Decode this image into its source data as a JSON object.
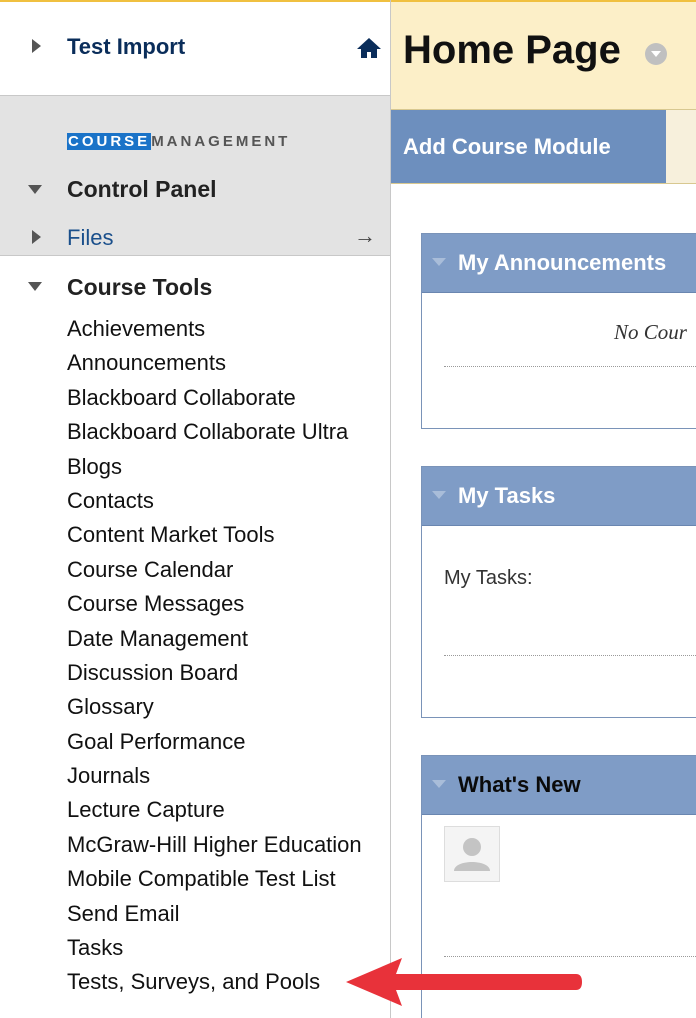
{
  "sidebar": {
    "course_title": "Test Import",
    "management_heading_part1": "COURSE",
    "management_heading_part2": "MANAGEMENT",
    "control_panel_label": "Control Panel",
    "files_label": "Files",
    "files_arrow": "→",
    "course_tools_label": "Course Tools",
    "tools": [
      "Achievements",
      "Announcements",
      "Blackboard Collaborate",
      "Blackboard Collaborate Ultra",
      "Blogs",
      "Contacts",
      "Content Market Tools",
      "Course Calendar",
      "Course Messages",
      "Date Management",
      "Discussion Board",
      "Glossary",
      "Goal Performance",
      "Journals",
      "Lecture Capture",
      "McGraw-Hill Higher Education",
      "Mobile Compatible Test List",
      "Send Email",
      "Tasks",
      "Tests, Surveys, and Pools"
    ]
  },
  "main": {
    "page_title": "Home Page",
    "add_module_label": "Add Course Module",
    "modules": {
      "announcements": {
        "title": "My Announcements",
        "empty_text": "No Cour"
      },
      "tasks": {
        "title": "My Tasks",
        "body_label": "My Tasks:"
      },
      "whats_new": {
        "title": "What's New"
      }
    }
  },
  "colors": {
    "header_bg": "#fcefc8",
    "module_header": "#7f9cc6",
    "add_module_button": "#6d8fbe",
    "annotation_arrow": "#e8323a",
    "link_blue": "#1a4f8b",
    "highlight": "#1a73c8"
  },
  "icons": {
    "home": "home-icon",
    "expand_collapse": "triangle-icon",
    "annotation": "red-arrow-icon"
  }
}
